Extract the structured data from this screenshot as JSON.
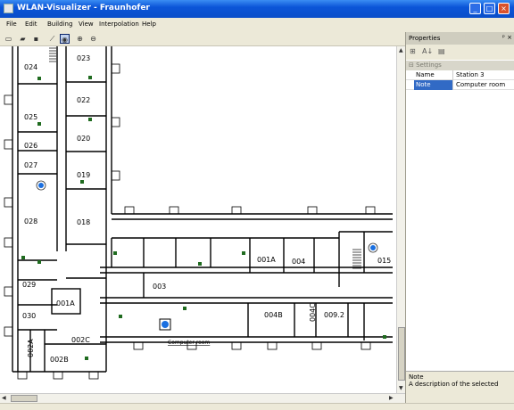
{
  "window": {
    "title": "WLAN-Visualizer - Fraunhofer",
    "minimize": "_",
    "maximize": "□",
    "close": "×"
  },
  "menu": [
    "File",
    "Edit",
    "Building",
    "View",
    "Interpolation",
    "Help"
  ],
  "toolbar": [
    {
      "name": "new-icon",
      "glyph": "▭"
    },
    {
      "name": "open-icon",
      "glyph": "▰"
    },
    {
      "name": "save-icon",
      "glyph": "▪"
    },
    {
      "name": "draw-icon",
      "glyph": "⟋"
    },
    {
      "name": "station-tool-icon",
      "glyph": "◉"
    },
    {
      "name": "zoom-in-icon",
      "glyph": "⊕"
    },
    {
      "name": "zoom-out-icon",
      "glyph": "⊖"
    }
  ],
  "floorplan": {
    "rooms": [
      "024",
      "023",
      "025",
      "022",
      "026",
      "020",
      "027",
      "019",
      "028",
      "018",
      "029",
      "030",
      "001A",
      "002A",
      "002B",
      "002C",
      "003",
      "001A",
      "004",
      "004B",
      "004C",
      "009.2",
      "015"
    ],
    "station_label": "Computer room"
  },
  "properties": {
    "title": "Properties",
    "controls": "ᵖ ×",
    "tools": [
      "⊞",
      "A↓",
      "▤"
    ],
    "category": "Settings",
    "rows": [
      {
        "key": "Name",
        "value": "Station 3"
      },
      {
        "key": "Note",
        "value": "Computer room"
      }
    ],
    "desc_title": "Note",
    "desc_text": "A description of the selected"
  },
  "colors": {
    "titlebar": "#0b55d8",
    "station": "#1a6fe0",
    "selection": "#316ac5",
    "sensor": "#1f6b1f"
  }
}
